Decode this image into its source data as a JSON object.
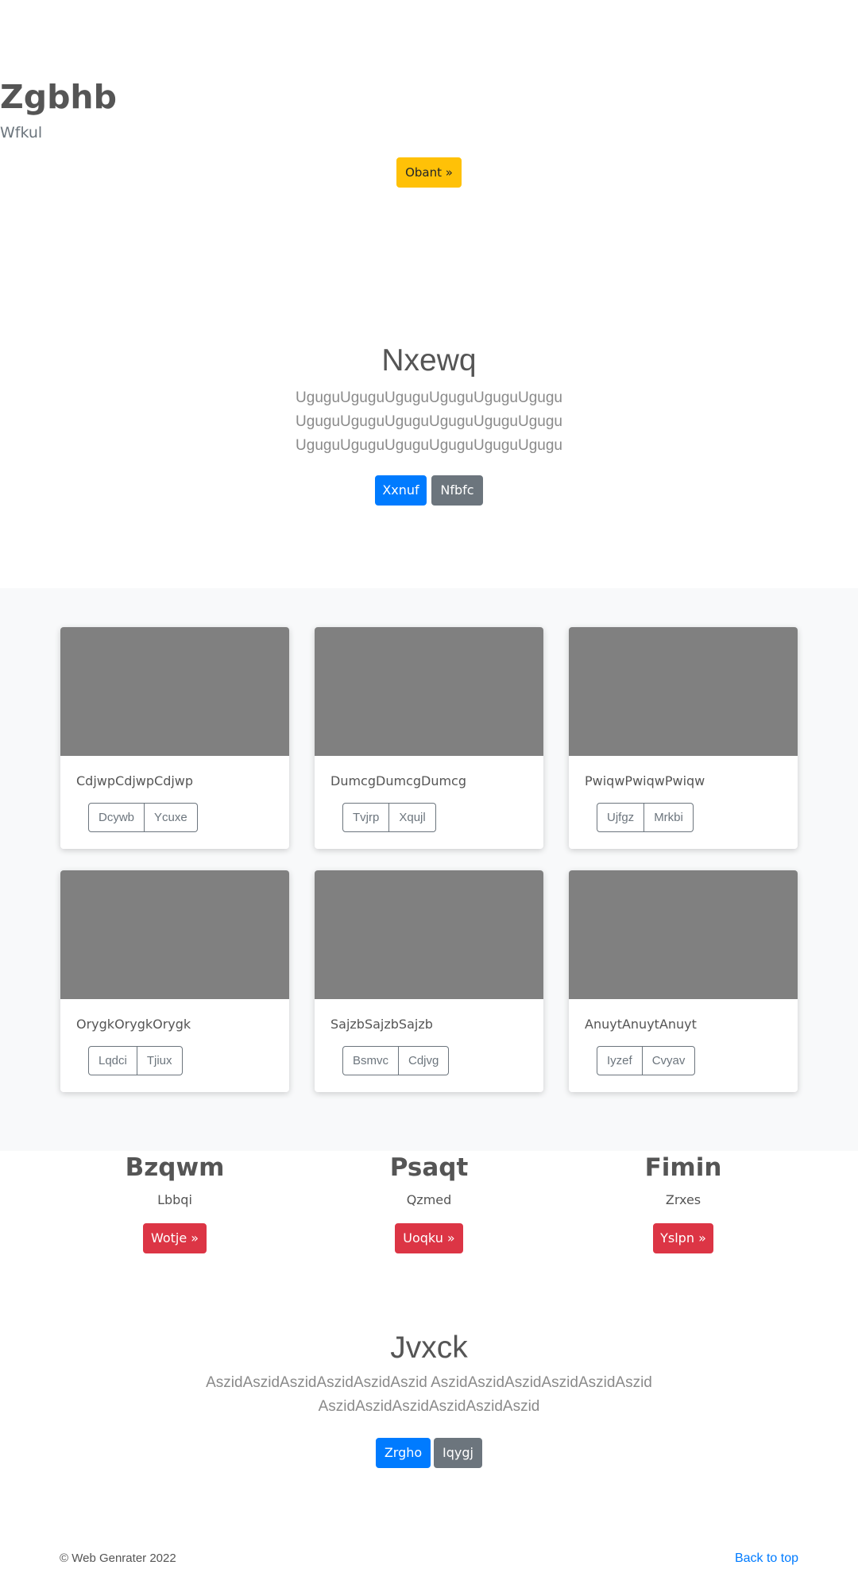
{
  "hero": {
    "title": "Zgbhb",
    "subtitle": "Wfkul",
    "button": "Obant »"
  },
  "jumbotron1": {
    "title": "Nxewq",
    "lines": [
      "UguguUguguUguguUguguUguguUgugu",
      "UguguUguguUguguUguguUguguUgugu",
      "UguguUguguUguguUguguUguguUgugu"
    ],
    "primary_button": "Xxnuf",
    "secondary_button": "Nfbfc"
  },
  "cards": [
    {
      "text": "CdjwpCdjwpCdjwp",
      "button_a": "Dcywb",
      "button_b": "Ycuxe"
    },
    {
      "text": "DumcgDumcgDumcg",
      "button_a": "Tvjrp",
      "button_b": "Xqujl"
    },
    {
      "text": "PwiqwPwiqwPwiqw",
      "button_a": "Ujfgz",
      "button_b": "Mrkbi"
    },
    {
      "text": "OrygkOrygkOrygk",
      "button_a": "Lqdci",
      "button_b": "Tjiux"
    },
    {
      "text": "SajzbSajzbSajzb",
      "button_a": "Bsmvc",
      "button_b": "Cdjvg"
    },
    {
      "text": "AnuytAnuytAnuyt",
      "button_a": "Iyzef",
      "button_b": "Cvyav"
    }
  ],
  "features": [
    {
      "title": "Bzqwm",
      "subtitle": "Lbbqi",
      "button": "Wotje »"
    },
    {
      "title": "Psaqt",
      "subtitle": "Qzmed",
      "button": "Uoqku »"
    },
    {
      "title": "Fimin",
      "subtitle": "Zrxes",
      "button": "Yslpn »"
    }
  ],
  "jumbotron2": {
    "title": "Jvxck",
    "text": "AszidAszidAszidAszidAszidAszid AszidAszidAszidAszidAszidAszid AszidAszidAszidAszidAszidAszid",
    "primary_button": "Zrgho",
    "secondary_button": "Iqygj"
  },
  "footer": {
    "copyright": "© Web Genrater 2022",
    "back_to_top": "Back to top"
  },
  "colors": {
    "warning": "#ffc107",
    "primary": "#007bff",
    "secondary": "#6c757d",
    "danger": "#dc3545",
    "placeholder_image": "#808080"
  }
}
